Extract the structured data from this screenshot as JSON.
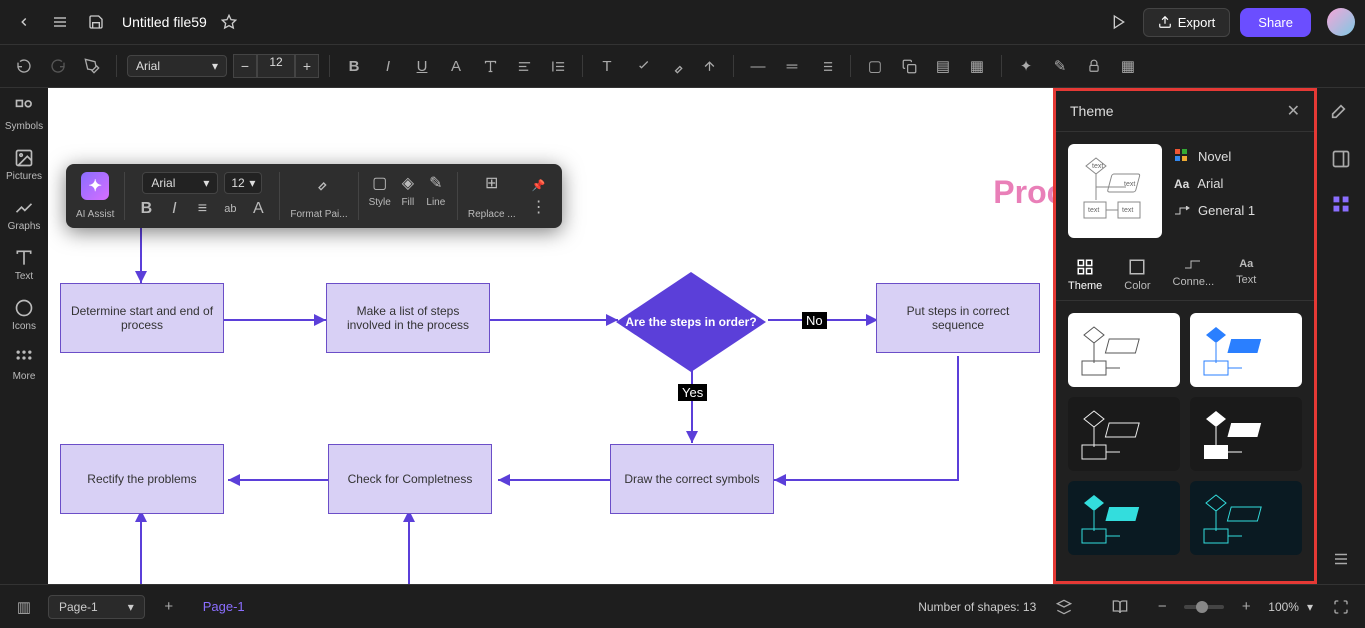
{
  "header": {
    "title": "Untitled file59",
    "export": "Export",
    "share": "Share"
  },
  "toolbar": {
    "font": "Arial",
    "size": "12"
  },
  "leftbar": {
    "symbols": "Symbols",
    "pictures": "Pictures",
    "graphs": "Graphs",
    "text": "Text",
    "icons": "Icons",
    "more": "More"
  },
  "float": {
    "ai": "AI Assist",
    "font": "Arial",
    "size": "12",
    "format": "Format Pai...",
    "style": "Style",
    "fill": "Fill",
    "line": "Line",
    "replace": "Replace ..."
  },
  "canvas": {
    "title": "Process Map Examples",
    "shapes": {
      "s1": "Determine start and end\nof process",
      "s2": "Make a list of steps\ninvolved in the process",
      "s3": "Are the steps in\norder?",
      "s4": "Put steps in correct\nsequence",
      "s5": "Draw the\ncorrect symbols",
      "s6": "Check for\nCompletness",
      "s7": "Rectify the problems"
    },
    "labels": {
      "yes": "Yes",
      "no": "No"
    }
  },
  "rightpanel": {
    "title": "Theme",
    "name": "Novel",
    "font": "Arial",
    "conn": "General 1",
    "tabs": {
      "theme": "Theme",
      "color": "Color",
      "conn": "Conne...",
      "text": "Text"
    }
  },
  "bottombar": {
    "page_sel": "Page-1",
    "page_tab": "Page-1",
    "shapes": "Number of shapes: 13",
    "zoom": "100%"
  }
}
